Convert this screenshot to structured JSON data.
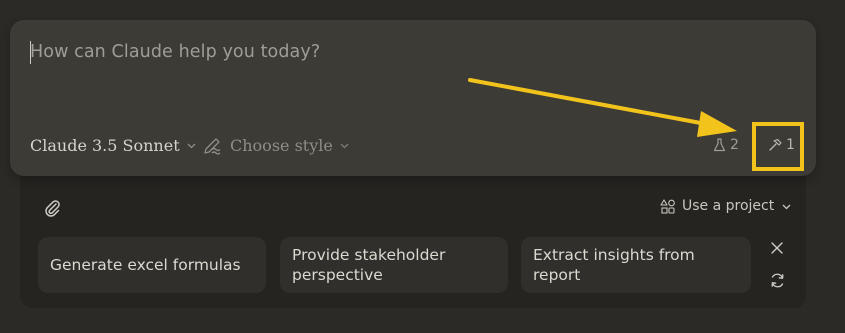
{
  "composer": {
    "placeholder": "How can Claude help you today?",
    "model_label": "Claude 3.5 Sonnet",
    "style_label": "Choose style",
    "research_count": "2",
    "tools_count": "1"
  },
  "tray": {
    "use_project_label": "Use a project",
    "suggestions": [
      {
        "line1": "Generate excel formulas",
        "line2": ""
      },
      {
        "line1": "Provide stakeholder",
        "line2": "perspective"
      },
      {
        "line1": "Extract insights from",
        "line2": "report"
      }
    ]
  },
  "icons": {
    "style": "pen-waves-icon",
    "research": "flask-icon",
    "tools": "hammer-icon",
    "attach": "paperclip-icon",
    "project": "shapes-icon",
    "close": "close-icon",
    "refresh": "refresh-icon"
  },
  "colors": {
    "annotation": "#f2c31b",
    "composer_bg": "#3c3b36",
    "page_bg": "#2b2a27"
  }
}
